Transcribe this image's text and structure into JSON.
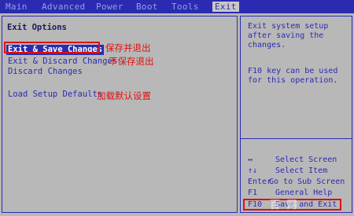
{
  "menu": {
    "items": [
      "Main",
      "Advanced",
      "Power",
      "Boot",
      "Tools",
      "Exit"
    ],
    "active_index": 5
  },
  "main": {
    "title": "Exit Options",
    "options": [
      {
        "label": "Exit & Save Changes",
        "note": "保存并退出"
      },
      {
        "label": "Exit & Discard Changes",
        "note": "不保存退出"
      },
      {
        "label": "Discard Changes",
        "note": ""
      },
      {
        "label": "Load Setup Defaults",
        "note": "加载默认设置"
      }
    ],
    "selected_index": 0
  },
  "help": {
    "description": "Exit system setup\nafter saving the\nchanges.",
    "f10_note": "F10 key can be used\nfor this operation."
  },
  "keys": [
    {
      "key": "↔",
      "desc": "Select Screen"
    },
    {
      "key": "↑↓",
      "desc": "Select Item"
    },
    {
      "key": "Enter",
      "desc": "Go to Sub Screen"
    },
    {
      "key": "F1",
      "desc": "General Help"
    },
    {
      "key": "F10",
      "desc": "Save and Exit"
    }
  ],
  "watermark": "百 网",
  "colors": {
    "bios_blue": "#2b2bb2",
    "bios_gray": "#b8b8b8",
    "annotation_red": "#e01010"
  }
}
